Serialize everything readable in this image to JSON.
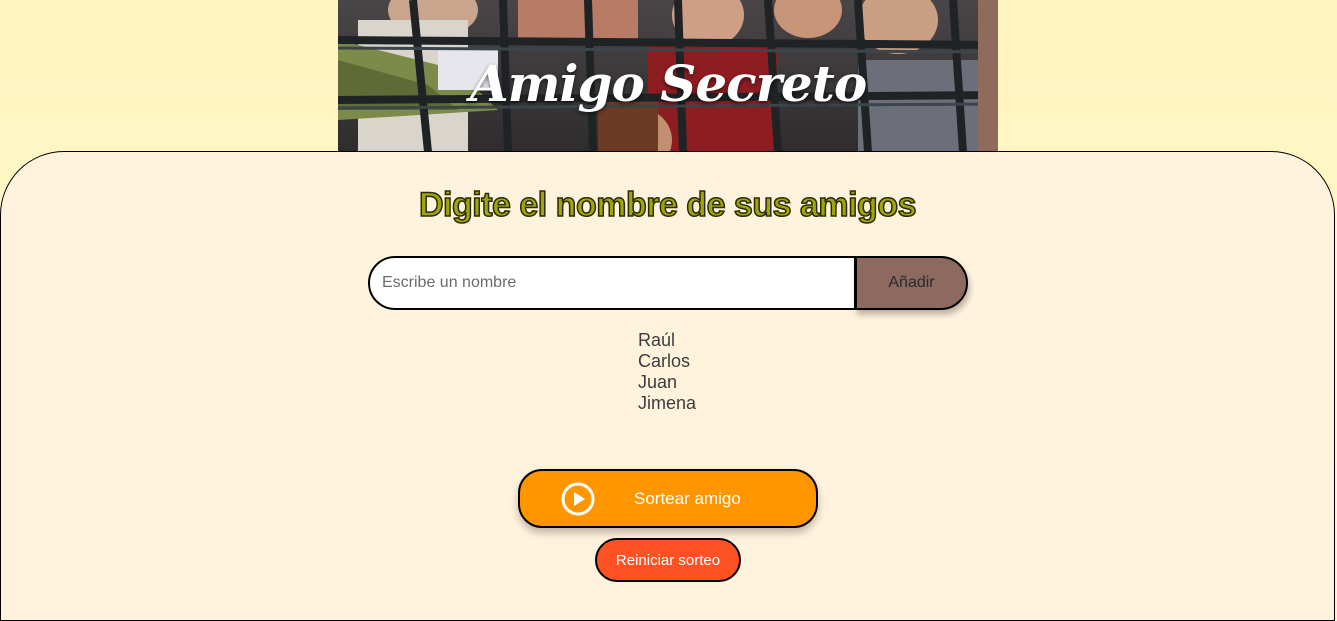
{
  "header": {
    "title": "Amigo Secreto"
  },
  "main": {
    "section_title": "Digite el nombre de sus amigos",
    "name_input": {
      "value": "",
      "placeholder": "Escribe un nombre"
    },
    "add_button_label": "Añadir",
    "friends": [
      "Raúl",
      "Carlos",
      "Juan",
      "Jimena"
    ],
    "draw_button_label": "Sortear amigo",
    "reset_button_label": "Reiniciar sorteo"
  },
  "icons": {
    "draw_button_icon": "play-circle-icon"
  },
  "colors": {
    "page_background": "#fff5bf",
    "panel_background": "#fff3de",
    "title_accent": "#9fa60b",
    "add_button": "#8c6a60",
    "draw_button": "#ff9600",
    "reset_button": "#fe5224"
  }
}
